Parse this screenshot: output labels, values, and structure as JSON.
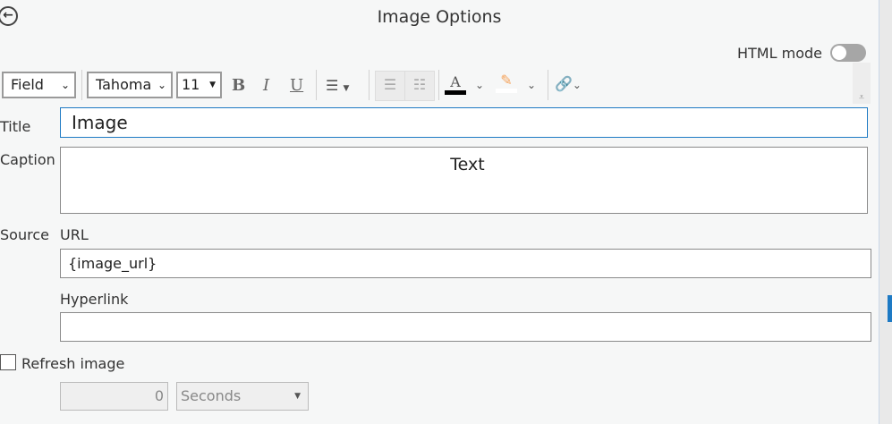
{
  "header": {
    "title": "Image Options",
    "html_mode_label": "HTML mode",
    "html_mode_on": false
  },
  "toolbar": {
    "field_label": "Field",
    "font": "Tahoma",
    "size": "11",
    "bold": "B",
    "italic": "I",
    "underline": "U",
    "font_color": "#000000",
    "highlight_color": "#ffffff"
  },
  "form": {
    "title_label": "Title",
    "title_value": "Image",
    "caption_label": "Caption",
    "caption_value": "Text",
    "source_label": "Source",
    "url_label": "URL",
    "url_value": "{image_url}",
    "hyperlink_label": "Hyperlink",
    "hyperlink_value": "",
    "refresh_label": "Refresh image",
    "refresh_checked": false,
    "interval_value": "0",
    "interval_unit": "Seconds"
  }
}
